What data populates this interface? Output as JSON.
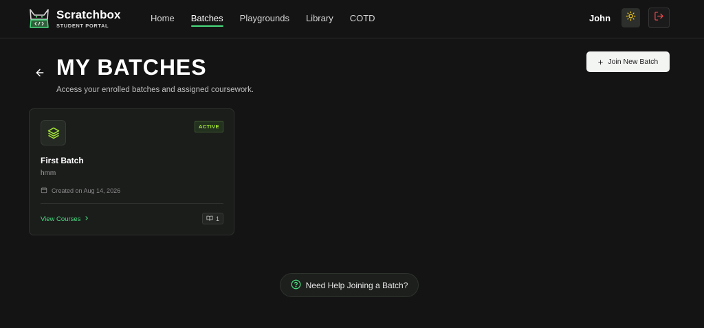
{
  "brand": {
    "name": "Scratchbox",
    "subtitle": "STUDENT PORTAL",
    "logo_icon": "cat-laptop-logo-icon"
  },
  "nav": {
    "items": [
      {
        "label": "Home",
        "active": false
      },
      {
        "label": "Batches",
        "active": true
      },
      {
        "label": "Playgrounds",
        "active": false
      },
      {
        "label": "Library",
        "active": false
      },
      {
        "label": "COTD",
        "active": false
      }
    ]
  },
  "user": {
    "name": "John",
    "theme_icon": "sun-icon",
    "logout_icon": "logout-icon"
  },
  "page": {
    "title": "MY BATCHES",
    "subtitle": "Access your enrolled batches and assigned coursework.",
    "back_icon": "arrow-left-icon",
    "join_button": {
      "icon": "+",
      "label": "Join New Batch"
    }
  },
  "batches": [
    {
      "title": "First Batch",
      "description": "hmm",
      "status": "ACTIVE",
      "created": "Created on Aug 14, 2026",
      "view_label": "View Courses",
      "course_count": "1",
      "icon": "layers-icon"
    }
  ],
  "help": {
    "label": "Need Help Joining a Batch?",
    "icon": "question-circle-icon"
  },
  "colors": {
    "background": "#141414",
    "accent": "#4ade80",
    "badge_text": "#a3e635",
    "logout_red": "#e5484d",
    "sun_yellow": "#facc15"
  }
}
